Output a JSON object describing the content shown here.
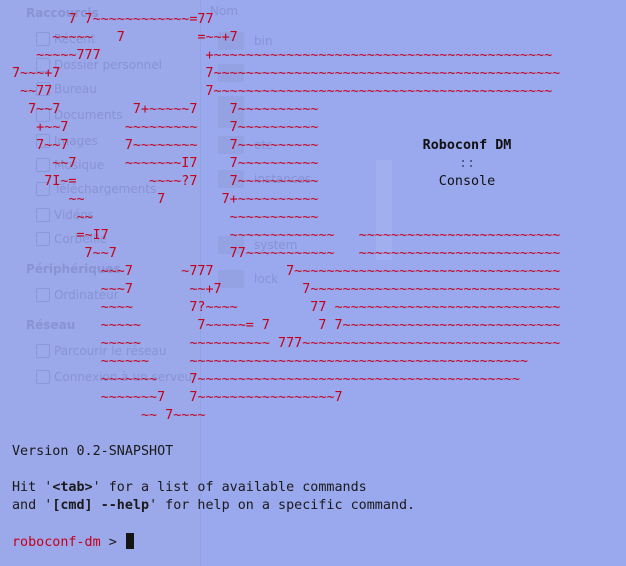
{
  "background_app": {
    "sidebar": {
      "sections": [
        {
          "label": "Raccourcis",
          "items": [
            "Récent",
            "Dossier personnel",
            "Bureau",
            "Documents",
            "Images",
            "Musique",
            "Téléchargements",
            "Vidéos",
            "Corbeille"
          ]
        },
        {
          "label": "Périphériques",
          "items": [
            "Ordinateur"
          ]
        },
        {
          "label": "Réseau",
          "items": [
            "Parcourir le réseau",
            "Connexion à un serveur"
          ]
        }
      ]
    },
    "file_list": {
      "column": "Nom",
      "items": [
        "bin",
        "",
        "",
        "",
        "etc",
        "",
        "instances",
        "",
        "",
        "system",
        "lock"
      ]
    }
  },
  "terminal": {
    "logo_lines": [
      "       7 7~~~~~~~~~~~~=77",
      "     ~~~~~   7         =~~+7",
      "   ~~~~~777             +~~~~~~~~~~~~~~~~~~~~~~~~~~~~~~~~~~~~~~~~~~",
      "7~~~+7                  7~~~~~~~~~~~~~~~~~~~~~~~~~~~~~~~~~~~~~~~~~~~",
      " ~~77                   7~~~~~~~~~~~~~~~~~~~~~~~~~~~~~~~~~~~~~~~~~~",
      "  7~~7         7+~~~~~7    7~~~~~~~~~~",
      "   +~~7       ~~~~~~~~~    7~~~~~~~~~~",
      "   7~~7       7~~~~~~~~    7~~~~~~~~~~",
      "     ~~7      ~~~~~~~I7    7~~~~~~~~~~",
      "    7I~=         ~~~~?7    7~~~~~~~~~~",
      "       ~~         7       7+~~~~~~~~~~",
      "        ~~                 ~~~~~~~~~~~",
      "        =~I7               ~~~~~~~~~~~~~   ~~~~~~~~~~~~~~~~~~~~~~~~~",
      "         7~~7              77~~~~~~~~~~~   ~~~~~~~~~~~~~~~~~~~~~~~~~",
      "           ~~~7      ~777         7~~~~~~~~~~~~~~~~~~~~~~~~~~~~~~~~~",
      "           ~~~7       ~~+7          7~~~~~~~~~~~~~~~~~~~~~~~~~~~~~~~",
      "           ~~~~       7?~~~~         77 ~~~~~~~~~~~~~~~~~~~~~~~~~~~~",
      "           ~~~~~       7~~~~~= 7      7 7~~~~~~~~~~~~~~~~~~~~~~~~~~~",
      "           ~~~~~      ~~~~~~~~~~ 777~~~~~~~~~~~~~~~~~~~~~~~~~~~~~~~~",
      "           ~~~~~~     ~~~~~~~~~~~~~~~~~~~~~~~~~~~~~~~~~~~~~~~~~~",
      "           ~~~~~~~    7~~~~~~~~~~~~~~~~~~~~~~~~~~~~~~~~~~~~~~~~",
      "           ~~~~~~~7   7~~~~~~~~~~~~~~~~~7",
      "                ~~ 7~~~~"
    ],
    "brand_title": "Roboconf DM",
    "brand_separator": "::",
    "brand_subtitle": "Console",
    "version_line": "Version 0.2-SNAPSHOT",
    "help_line1": {
      "pre": "Hit '",
      "key": "<tab>",
      "post": "' for a list of available commands"
    },
    "help_line2": {
      "pre": "and '",
      "key1": "[cmd]",
      "mid": " ",
      "key2": "--help",
      "post": "' for help on a specific command."
    },
    "prompt": "roboconf-dm",
    "prompt_symbol": " > ",
    "colors": {
      "background": "#9aa8ee",
      "logo": "#c4001a",
      "text": "#1a1a1a",
      "cursor": "#141414"
    }
  }
}
